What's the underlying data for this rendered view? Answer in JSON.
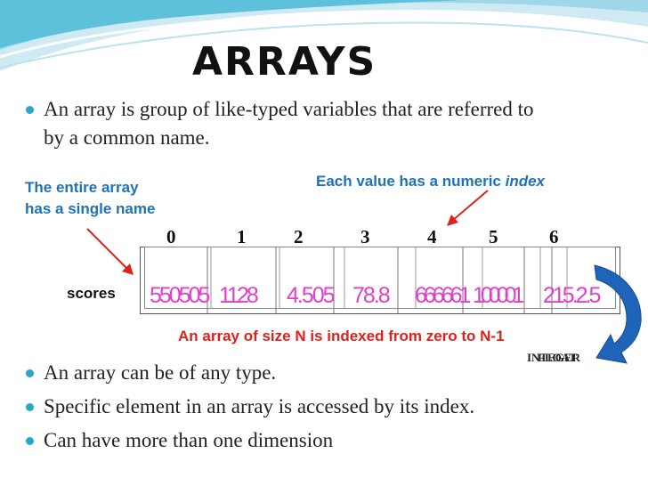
{
  "title": "ARRAYS",
  "intro_bullet": {
    "line1": "An array is group of like-typed variables that are referred to",
    "line2": "by a common name."
  },
  "notes": {
    "entire_array_line1": "The entire array",
    "entire_array_line2": "has a single name",
    "index_prefix": "Each value has a numeric ",
    "index_word": "index",
    "size_note": "An array of size N is indexed from zero to N-1",
    "integer_label": "INTEGER",
    "float_label": "FLOAT"
  },
  "array": {
    "name_label": "scores",
    "indices": [
      "0",
      "1",
      "2",
      "3",
      "4",
      "5",
      "6"
    ],
    "values": [
      "550505",
      "1128",
      "4.505",
      "78.8",
      "666661",
      "100001",
      "215.2.5"
    ]
  },
  "bullets": [
    "An  array can be of any type.",
    "Specific element in an array is accessed by its index.",
    "Can have more than one dimension"
  ],
  "colors": {
    "accent_cyan": "#27a9c9",
    "note_blue": "#1e72b8",
    "note_red": "#e0201a",
    "value_magenta": "#e040c8",
    "arrow_blue": "#1f64b8"
  }
}
